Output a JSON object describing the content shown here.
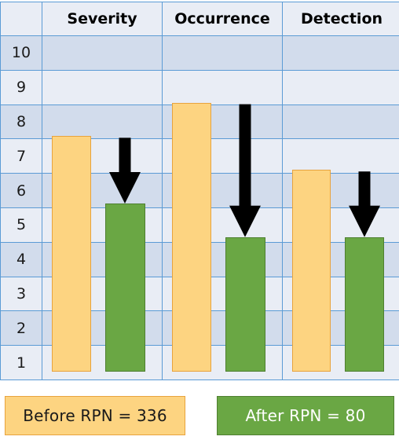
{
  "chart_data": {
    "type": "bar",
    "title": "",
    "subtitle": "",
    "xlabel": "",
    "ylabel": "",
    "categories": [
      "Severity",
      "Occurrence",
      "Detection"
    ],
    "series": [
      {
        "name": "Before RPN = 336",
        "color": "#fdd481",
        "values": [
          7.5,
          8.5,
          6.5
        ]
      },
      {
        "name": "After RPN = 80",
        "color": "#6aa744",
        "values": [
          5.5,
          4.5,
          4.5
        ]
      }
    ],
    "ylim": [
      0,
      10
    ],
    "yticks": [
      "10",
      "9",
      "8",
      "7",
      "6",
      "5",
      "4",
      "3",
      "2",
      "1"
    ],
    "grid": true,
    "legend_position": "bottom",
    "annotations": [
      {
        "type": "down-arrow",
        "category": "Severity",
        "from": 7.5,
        "to": 5.5
      },
      {
        "type": "down-arrow",
        "category": "Occurrence",
        "from": 8.5,
        "to": 4.5
      },
      {
        "type": "down-arrow",
        "category": "Detection",
        "from": 6.5,
        "to": 4.5
      }
    ],
    "colors": {
      "before": "#fdd481",
      "before_border": "#e8a33d",
      "after": "#6aa744",
      "after_border": "#4f7f31",
      "grid_line": "#5b9bd5",
      "row_light": "#e9edf5",
      "row_dark": "#d2dcec",
      "arrow": "#000000"
    }
  },
  "table": {
    "corner_label": "",
    "headers": [
      "Severity",
      "Occurrence",
      "Detection"
    ],
    "axis_labels": [
      "10",
      "9",
      "8",
      "7",
      "6",
      "5",
      "4",
      "3",
      "2",
      "1"
    ]
  },
  "legend": {
    "before_label": "Before RPN = 336",
    "after_label": "After RPN = 80"
  }
}
